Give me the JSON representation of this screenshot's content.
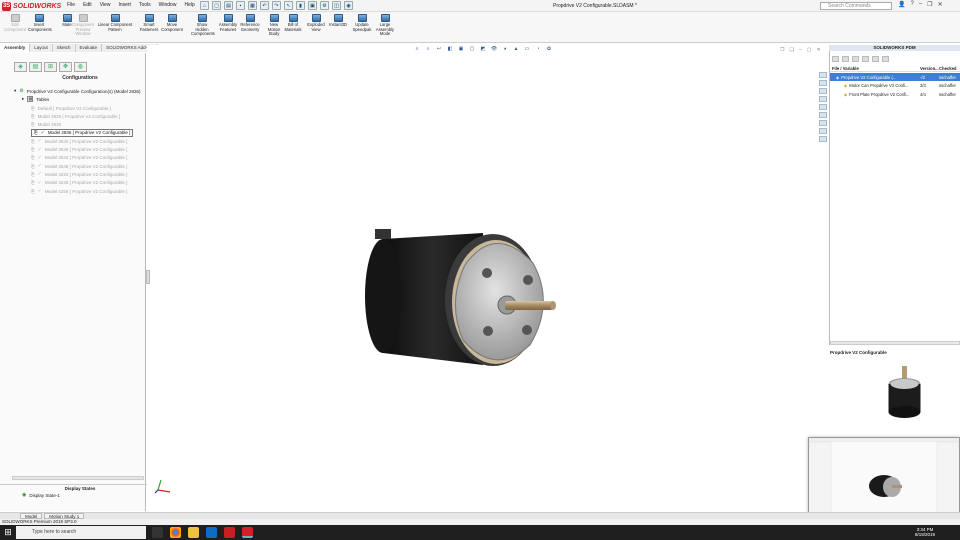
{
  "app": {
    "brand": "SOLIDWORKS",
    "doc_title": "Propdrive V2 Configurable.SLDASM *"
  },
  "menu": [
    "File",
    "Edit",
    "View",
    "Insert",
    "Tools",
    "Window",
    "Help"
  ],
  "search_placeholder": "Search Commands",
  "ribbon": [
    {
      "label": "Edit Component",
      "enabled": false
    },
    {
      "label": "Insert Components",
      "enabled": true
    },
    {
      "label": "Mate",
      "enabled": true
    },
    {
      "label": "Component Preview Window",
      "enabled": false
    },
    {
      "label": "Linear Component Pattern",
      "enabled": true
    },
    {
      "label": "Smart Fasteners",
      "enabled": true
    },
    {
      "label": "Move Component",
      "enabled": true
    },
    {
      "label": "Show Hidden Components",
      "enabled": true
    },
    {
      "label": "Assembly Features",
      "enabled": true
    },
    {
      "label": "Reference Geometry",
      "enabled": true
    },
    {
      "label": "New Motion Study",
      "enabled": true
    },
    {
      "label": "Bill of Materials",
      "enabled": true
    },
    {
      "label": "Exploded View",
      "enabled": true
    },
    {
      "label": "Instant3D",
      "enabled": true
    },
    {
      "label": "Update Speedpak",
      "enabled": true
    },
    {
      "label": "Large Assembly Mode",
      "enabled": true
    }
  ],
  "command_tabs": [
    "Assembly",
    "Layout",
    "Sketch",
    "Evaluate",
    "SOLIDWORKS Add-Ins"
  ],
  "configurations": {
    "title": "Configurations",
    "root": "Propdrive V2 Configurable Configuration(s)  (Model 2836)",
    "tables": "Tables",
    "items": [
      {
        "label": "Default [ Propdrive V2 Configurable ]",
        "active": false,
        "check": false
      },
      {
        "label": "Model 2826 [ Propdrive V2 Configurable ]",
        "active": false,
        "check": false
      },
      {
        "label": "Model 2830",
        "active": false,
        "check": false
      },
      {
        "label": "Model 2836 [ Propdrive V2 Configurable ]",
        "active": true,
        "check": true
      },
      {
        "label": "Model 3530 [ Propdrive V2 Configurable ]",
        "active": false,
        "check": true
      },
      {
        "label": "Model 3536 [ Propdrive V2 Configurable ]",
        "active": false,
        "check": true
      },
      {
        "label": "Model 3542 [ Propdrive V2 Configurable ]",
        "active": false,
        "check": true
      },
      {
        "label": "Model 3548 [ Propdrive V2 Configurable ]",
        "active": false,
        "check": true
      },
      {
        "label": "Model 4220 [ Propdrive V2 Configurable ]",
        "active": false,
        "check": true
      },
      {
        "label": "Model 4248 [ Propdrive V2 Configurable ]",
        "active": false,
        "check": true
      },
      {
        "label": "Model 4258 [ Propdrive V2 Configurable ]",
        "active": false,
        "check": true
      }
    ]
  },
  "display_states": {
    "title": "Display States",
    "item": "Display State-1"
  },
  "bottom_tabs": [
    "Model",
    "Motion Study 1"
  ],
  "status": "SOLIDWORKS Premium 2019 SP3.0",
  "pdm": {
    "title": "SOLIDWORKS PDM",
    "columns": [
      "File / Variable",
      "Version...",
      "Checked"
    ],
    "rows": [
      {
        "name": "Propdrive V2 Configurable (...",
        "version": "-/3",
        "checked": "sschaffer",
        "selected": true
      },
      {
        "name": "Motor Can Propdrive V2 Confi...",
        "version": "3/3",
        "checked": "sschaffer",
        "selected": false
      },
      {
        "name": "Front Plate Propdrive V2 Confi...",
        "version": "4/4",
        "checked": "sschaffer",
        "selected": false
      }
    ],
    "preview_title": "Propdrive V2 Configurable"
  },
  "taskbar": {
    "search": "Type here to search",
    "time": "3:34 PM",
    "date": "8/19/2019"
  },
  "colors": {
    "accent": "#d32027",
    "select": "#3c7fd3",
    "motor_can": "#1a1a1a"
  }
}
